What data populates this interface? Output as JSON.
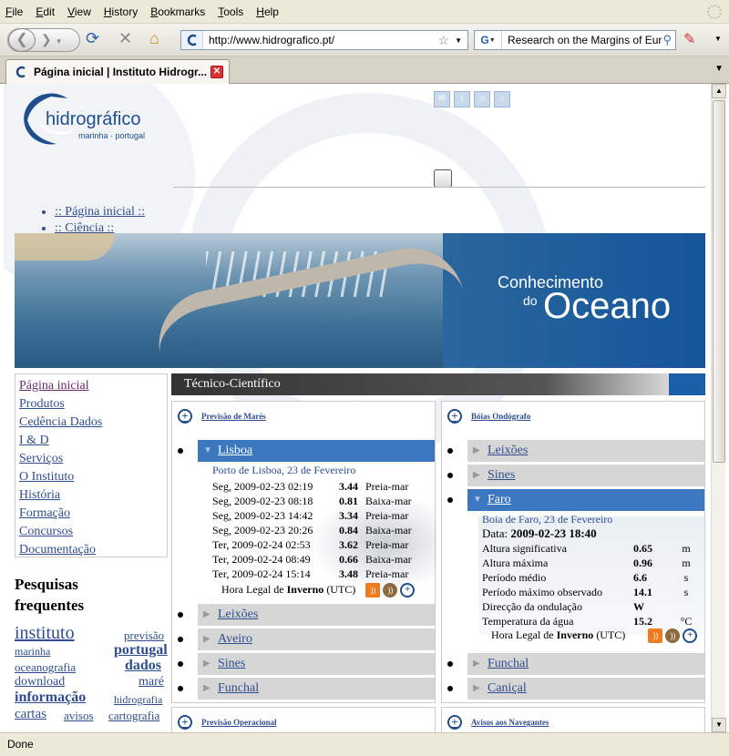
{
  "menu": [
    "File",
    "Edit",
    "View",
    "History",
    "Bookmarks",
    "Tools",
    "Help"
  ],
  "menu_underline": [
    "F",
    "E",
    "V",
    "H",
    "B",
    "T",
    "H"
  ],
  "menu_rest": [
    "ile",
    "dit",
    "iew",
    "istory",
    "ookmarks",
    "ools",
    "elp"
  ],
  "url": "http://www.hidrografico.pt/",
  "search_engine": "G",
  "search_text": "Research on the Margins of Europe",
  "tab_title": "Página inicial | Instituto Hidrogr...",
  "status": "Done",
  "logo": {
    "main": "hidrográfico",
    "sub": "marinha · portugal"
  },
  "top_links": [
    "Página inicial",
    "Ciência"
  ],
  "banner": {
    "line1": "Conhecimento",
    "line2": "do",
    "line3": "Oceano"
  },
  "left_nav": [
    "Página inicial",
    "Produtos",
    "Cedência Dados",
    "I & D",
    "Serviços",
    "O Instituto",
    "História",
    "Formação",
    "Concursos",
    "Documentação"
  ],
  "pesquisas_title": [
    "Pesquisas",
    "frequentes"
  ],
  "tags": [
    "instituto",
    "previsão",
    "marinha",
    "portugal",
    "oceanografia",
    "dados",
    "download",
    "maré",
    "informação",
    "hidrografia",
    "cartas",
    "avisos",
    "cartografia"
  ],
  "section_title": "Técnico-Científico",
  "previsao_mares": {
    "title": "Previsão de Marés",
    "open_item": "Lisboa",
    "subtitle": "Porto de Lisboa, 23 de Fevereiro",
    "rows": [
      {
        "date": "Seg, 2009-02-23 02:19",
        "value": "3.44",
        "type": "Preia-mar"
      },
      {
        "date": "Seg, 2009-02-23 08:18",
        "value": "0.81",
        "type": "Baixa-mar"
      },
      {
        "date": "Seg, 2009-02-23 14:42",
        "value": "3.34",
        "type": "Preia-mar"
      },
      {
        "date": "Seg, 2009-02-23 20:26",
        "value": "0.84",
        "type": "Baixa-mar"
      },
      {
        "date": "Ter, 2009-02-24 02:53",
        "value": "3.62",
        "type": "Preia-mar"
      },
      {
        "date": "Ter, 2009-02-24 08:49",
        "value": "0.66",
        "type": "Baixa-mar"
      },
      {
        "date": "Ter, 2009-02-24 15:14",
        "value": "3.48",
        "type": "Preia-mar"
      }
    ],
    "hora_pre": "Hora Legal de ",
    "hora_bold": "Inverno",
    "hora_post": " (UTC)",
    "other_items": [
      "Leixões",
      "Aveiro",
      "Sines",
      "Funchal"
    ]
  },
  "boias": {
    "title": "Bóias Ondógrafo",
    "items_before": [
      "Leixões",
      "Sines"
    ],
    "open_item": "Faro",
    "subtitle": "Boia de Faro, 23 de Fevereiro",
    "data_label": "Data: ",
    "data_value": "2009-02-23 18:40",
    "rows": [
      {
        "label": "Altura significativa",
        "value": "0.65",
        "unit": "m"
      },
      {
        "label": "Altura máxima",
        "value": "0.96",
        "unit": "m"
      },
      {
        "label": "Período médio",
        "value": "6.6",
        "unit": "s"
      },
      {
        "label": "Período máximo observado",
        "value": "14.1",
        "unit": "s"
      },
      {
        "label": "Direcção da ondulação",
        "value": "W",
        "unit": ""
      },
      {
        "label": "Temperatura da água",
        "value": "15.2",
        "unit": "°C"
      }
    ],
    "items_after": [
      "Funchal",
      "Caniçal"
    ]
  },
  "bottom_panels": [
    "Previsão Operacional",
    "Avisos aos Navegantes"
  ]
}
